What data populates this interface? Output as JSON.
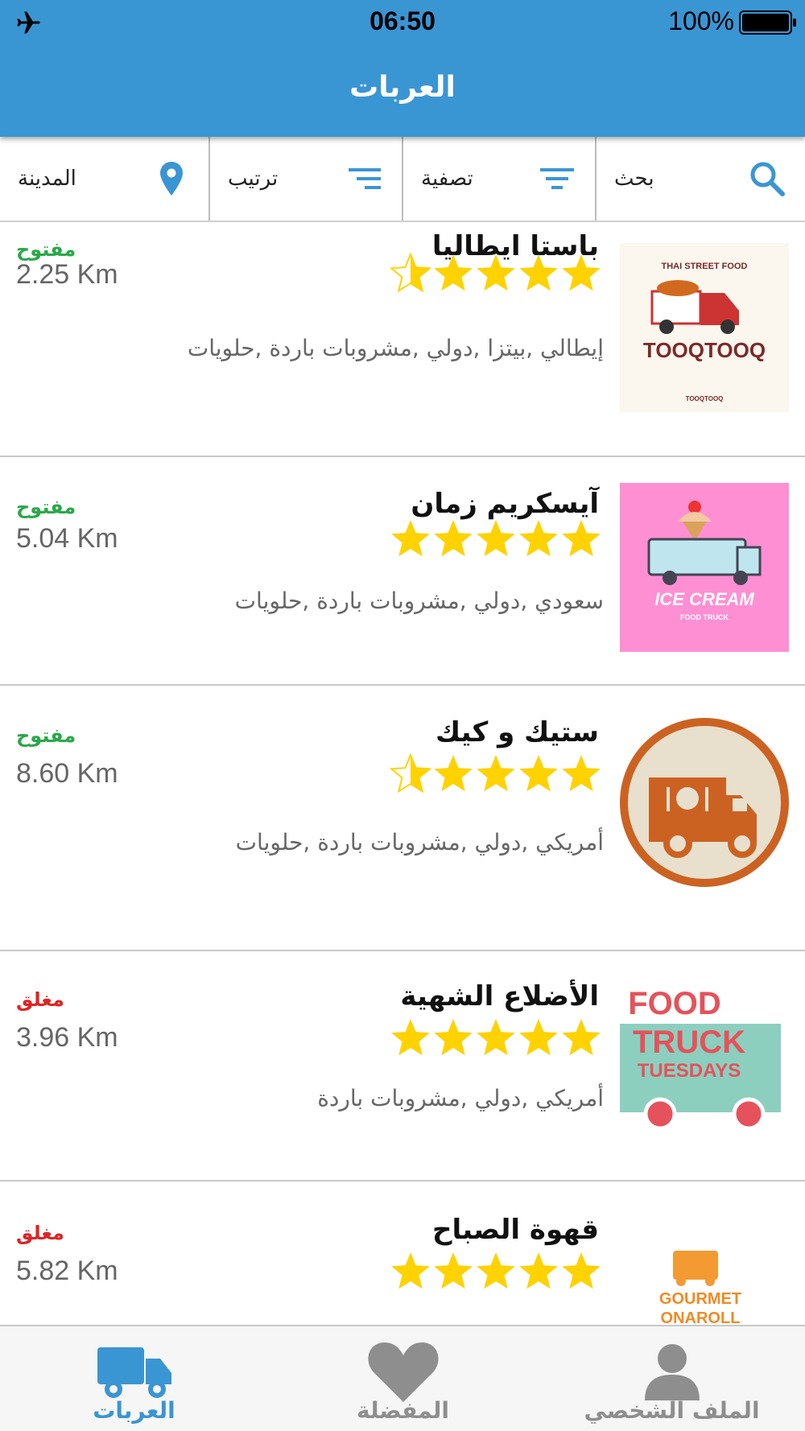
{
  "status_bar": {
    "time": "06:50",
    "battery": "100%"
  },
  "header": {
    "title": "العربات"
  },
  "toolbar": {
    "search_label": "بحث",
    "filter_label": "تصفية",
    "sort_label": "ترتيب",
    "city_label": "المدينة"
  },
  "colors": {
    "accent": "#3a95d3",
    "star": "#ffd200",
    "open": "#2aa84a",
    "closed": "#e02424",
    "inactive_tab": "#8e8e8e"
  },
  "trucks": [
    {
      "name": "باستا ايطاليا",
      "status": "مفتوح",
      "status_state": "open",
      "distance": "2.25 Km",
      "rating": 4.5,
      "tags": "إيطالي ,بيتزا ,دولي ,مشروبات باردة ,حلويات",
      "logo": "tooqtooq",
      "logo_text": {
        "top": "THAI STREET FOOD",
        "main": "TOOQTOOQ",
        "small": "TOOQTOOQ"
      }
    },
    {
      "name": "آيسكريم زمان",
      "status": "مفتوح",
      "status_state": "open",
      "distance": "5.04 Km",
      "rating": 5,
      "tags": "سعودي ,دولي ,مشروبات باردة ,حلويات",
      "logo": "ice-cream",
      "logo_text": {
        "main": "ICE CREAM",
        "sub": "FOOD TRUCK"
      }
    },
    {
      "name": "ستيك و كيك",
      "status": "مفتوح",
      "status_state": "open",
      "distance": "8.60 Km",
      "rating": 4.5,
      "tags": "أمريكي ,دولي ,مشروبات باردة ,حلويات",
      "logo": "truck-circle"
    },
    {
      "name": "الأضلاع الشهية",
      "status": "مغلق",
      "status_state": "closed",
      "distance": "3.96 Km",
      "rating": 5,
      "tags": "أمريكي ,دولي ,مشروبات باردة",
      "logo": "food-truck-tuesdays",
      "logo_text": {
        "line1": "FOOD",
        "line2": "TRUCK",
        "line3": "TUESDAYS"
      }
    },
    {
      "name": "قهوة الصباح",
      "status": "مغلق",
      "status_state": "closed",
      "distance": "5.82 Km",
      "rating": 5,
      "tags": "",
      "logo": "gourmet",
      "logo_text": {
        "main": "GOURMET",
        "sub": "ONAROLL"
      }
    }
  ],
  "tabs": [
    {
      "label": "الملف الشخصي",
      "icon": "person-icon",
      "active": false
    },
    {
      "label": "المفضلة",
      "icon": "heart-icon",
      "active": false
    },
    {
      "label": "العربات",
      "icon": "truck-icon",
      "active": true
    }
  ]
}
